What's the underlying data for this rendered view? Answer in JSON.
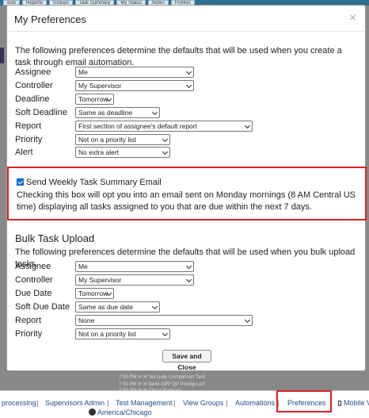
{
  "background": {
    "tabs": [
      "ests",
      "Reports",
      "Groups",
      "Task Summary",
      "My Status",
      "Notes",
      "Profiles"
    ],
    "footer_links": [
      "processing",
      "Supervisors Admin",
      "Test Management",
      "View Groups",
      "Automations",
      "Preferences",
      "Mobile V"
    ],
    "timezone": "America/Chicago",
    "faint_rows": [
      "7:00 PM ⟳ ✉ Tell Daily Comparison Task",
      "7:00 PM ⟳ ✉ Send GPP QP Priority List!",
      "7:00 PM ⟳ ✉ Check Backups"
    ]
  },
  "modal": {
    "title": "My Preferences",
    "close_symbol": "×",
    "intro": "The following preferences determine the defaults that will be used when you create a task through email automation.",
    "email_fields": [
      {
        "label": "Assignee",
        "value": "Me"
      },
      {
        "label": "Controller",
        "value": "My Supervisor"
      },
      {
        "label": "Deadline",
        "value": "Tomorrow"
      },
      {
        "label": "Soft Deadline",
        "value": "Same as deadline"
      },
      {
        "label": "Report",
        "value": "First section of assignee's default report"
      },
      {
        "label": "Priority",
        "value": "Not on a priority list"
      },
      {
        "label": "Alert",
        "value": "No extra alert"
      }
    ],
    "weekly_summary": {
      "checked": true,
      "label": "Send Weekly Task Summary Email",
      "description": "Checking this box will opt you into an email sent on Monday mornings (8 AM Central US time) displaying all tasks assigned to you that are due within the next 7 days."
    },
    "bulk": {
      "title": "Bulk Task Upload",
      "intro": "The following preferences determine the defaults that will be used when you bulk upload tasks.",
      "fields": [
        {
          "label": "Assignee",
          "value": "Me"
        },
        {
          "label": "Controller",
          "value": "My Supervisor"
        },
        {
          "label": "Due Date",
          "value": "Tomorrow"
        },
        {
          "label": "Soft Due Date",
          "value": "Same as due date"
        },
        {
          "label": "Report",
          "value": "None"
        },
        {
          "label": "Priority",
          "value": "Not on a priority list"
        }
      ]
    },
    "save_label": "Save and Close"
  },
  "colors": {
    "highlight": "#d92121",
    "link": "#1a4f8a",
    "checkbox": "#0a74da"
  }
}
